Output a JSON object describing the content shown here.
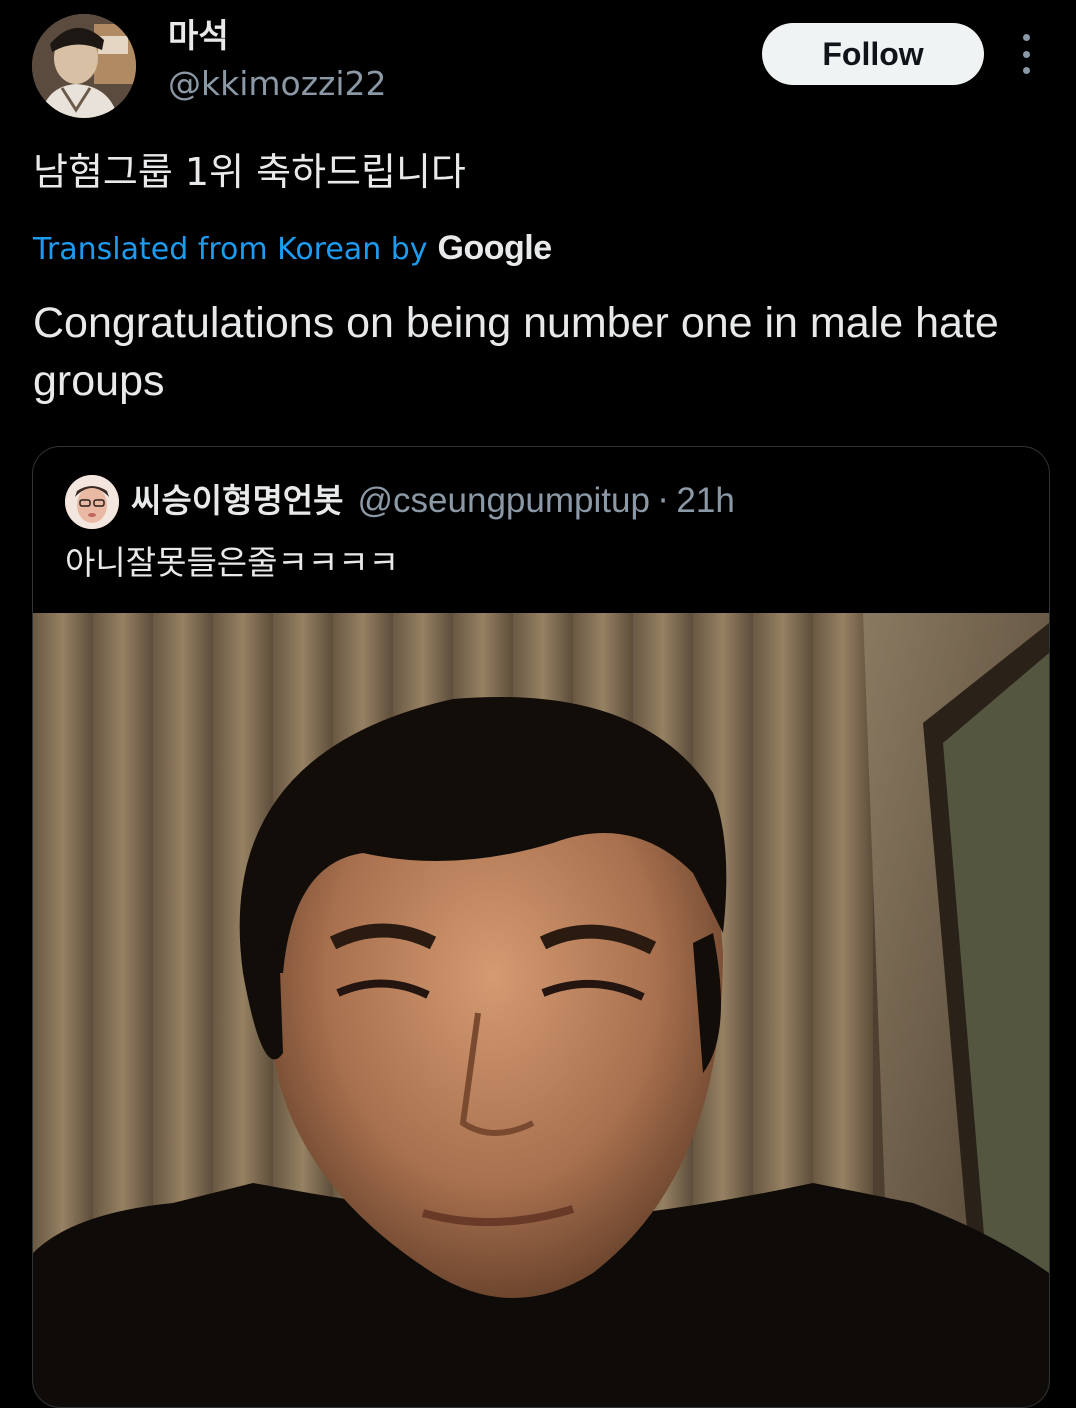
{
  "author": {
    "display_name": "마석",
    "handle": "@kkimozzi22",
    "avatar_icon": "user-avatar"
  },
  "follow_button": {
    "label": "Follow"
  },
  "more_menu": {
    "icon": "more-vertical-icon"
  },
  "tweet": {
    "text": "남혐그룹 1위 축하드립니다",
    "translated_label": "Translated from Korean by",
    "translator": "Google",
    "translation": "Congratulations on being number one in male hate groups"
  },
  "quoted_tweet": {
    "display_name": "씨승이형명언봇",
    "handle": "@cseungpumpitup",
    "separator": "·",
    "time": "21h",
    "text": "아니잘못들은줄ㅋㅋㅋㅋ",
    "media_icon": "video-thumbnail"
  },
  "colors": {
    "background": "#000000",
    "text_primary": "#e7e9ea",
    "text_secondary": "#8b98a5",
    "link": "#1d9bf0",
    "border": "#2f3336",
    "follow_bg": "#eff3f4"
  }
}
